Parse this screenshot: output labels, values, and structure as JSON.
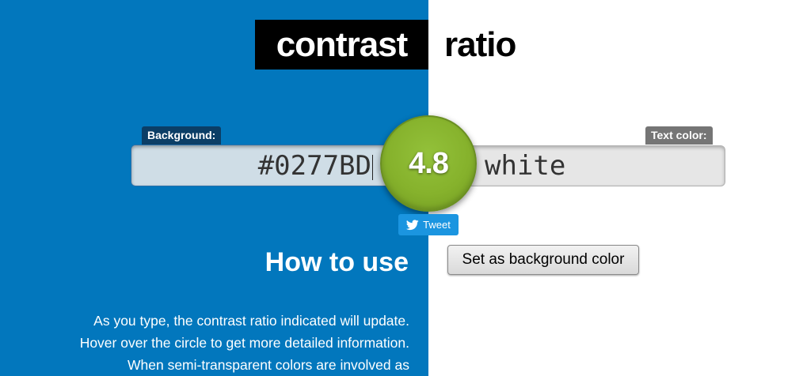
{
  "colors": {
    "background_pane": "#0277BD",
    "text_pane": "#ffffff",
    "ratio_circle": "#86b22c",
    "tweet_button": "#1b95e0"
  },
  "header": {
    "title_word_1": "contrast",
    "title_word_2": "ratio"
  },
  "background_field": {
    "label": "Background:",
    "value": "#0277BD"
  },
  "text_color_field": {
    "label": "Text color:",
    "value": "white"
  },
  "ratio": {
    "value": "4.8"
  },
  "tweet": {
    "label": "Tweet",
    "icon": "twitter-bird-icon"
  },
  "actions": {
    "set_background_label": "Set as background color"
  },
  "how_to_use": {
    "heading": "How to use",
    "lines": [
      "As you type, the contrast ratio indicated will update.",
      "Hover over the circle to get more detailed information.",
      "When semi-transparent colors are involved as"
    ]
  }
}
